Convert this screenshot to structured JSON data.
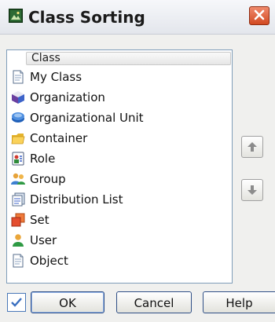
{
  "window": {
    "title": "Class Sorting"
  },
  "list": {
    "column_header": "Class",
    "items": [
      {
        "label": "My Class",
        "icon": "document-icon"
      },
      {
        "label": "Organization",
        "icon": "organization-cube-icon"
      },
      {
        "label": "Organizational Unit",
        "icon": "organizational-unit-icon"
      },
      {
        "label": "Container",
        "icon": "folder-icon"
      },
      {
        "label": "Role",
        "icon": "role-icon"
      },
      {
        "label": "Group",
        "icon": "group-icon"
      },
      {
        "label": "Distribution List",
        "icon": "distribution-list-icon"
      },
      {
        "label": "Set",
        "icon": "set-icon"
      },
      {
        "label": "User",
        "icon": "user-icon"
      },
      {
        "label": "Object",
        "icon": "document-icon"
      }
    ]
  },
  "buttons": {
    "ok": "OK",
    "cancel": "Cancel",
    "help": "Help"
  },
  "colors": {
    "accent": "#2f4f86",
    "list_border": "#7f9db9",
    "close": "#d24a22"
  }
}
